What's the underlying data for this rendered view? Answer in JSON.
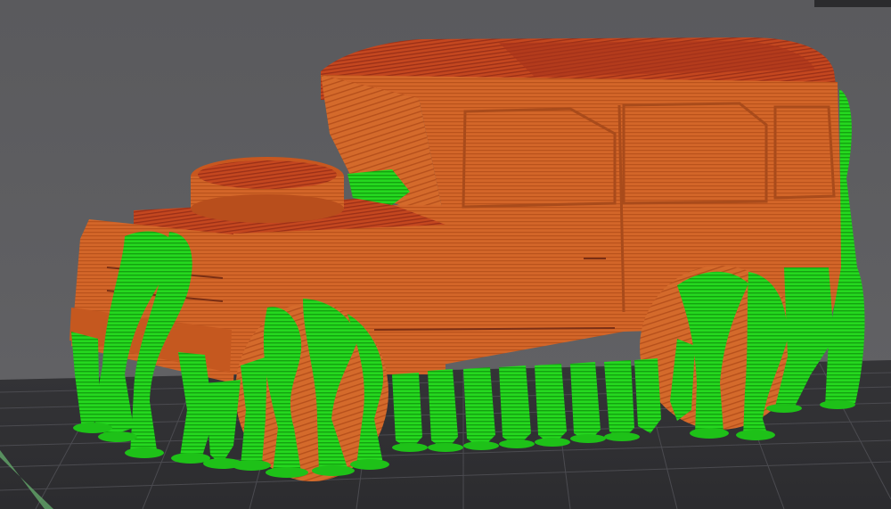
{
  "colors": {
    "background": "#5c5c5f",
    "bed": "#2f2f32",
    "bed_grid": "#4a4a4e",
    "model_orange": "#d5692a",
    "model_orange_dark": "#b7521d",
    "model_red_top": "#b23a1c",
    "support_green": "#22d61c",
    "support_green_dark": "#17a812",
    "bed_edge_accent": "#58a858"
  },
  "icons": {
    "viewport": "3d-viewport-icon",
    "corner_panel": "toolbar-panel-icon"
  }
}
